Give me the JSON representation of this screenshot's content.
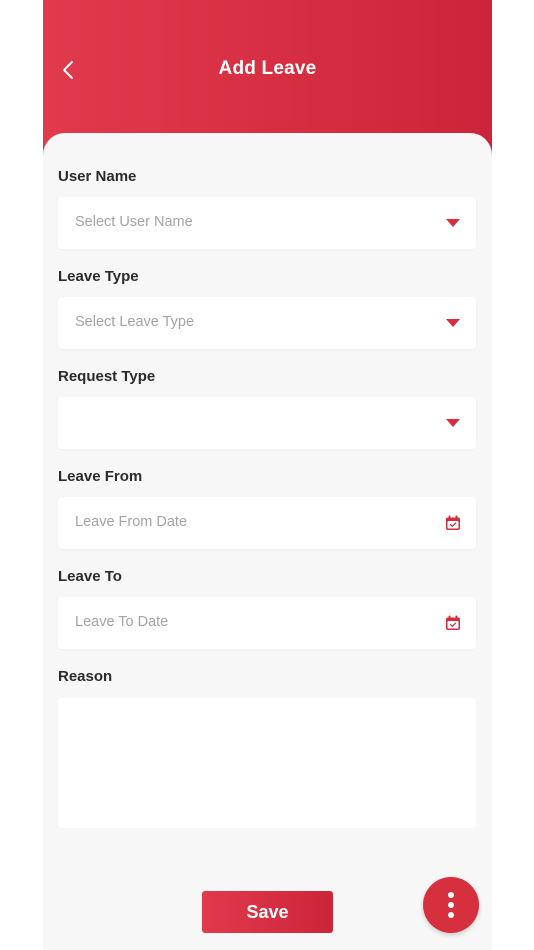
{
  "header": {
    "title": "Add Leave",
    "back_icon": "chevron-left-icon"
  },
  "form": {
    "user_name": {
      "label": "User Name",
      "placeholder": "Select User Name",
      "icon": "caret-down-icon"
    },
    "leave_type": {
      "label": "Leave Type",
      "placeholder": "Select Leave Type",
      "icon": "caret-down-icon"
    },
    "request_type": {
      "label": "Request Type",
      "placeholder": "",
      "icon": "caret-down-icon"
    },
    "leave_from": {
      "label": "Leave From",
      "placeholder": "Leave From Date",
      "icon": "calendar-icon"
    },
    "leave_to": {
      "label": "Leave To",
      "placeholder": "Leave To Date",
      "icon": "calendar-icon"
    },
    "reason": {
      "label": "Reason",
      "value": ""
    }
  },
  "actions": {
    "save_label": "Save",
    "more_icon": "more-vertical-icon"
  },
  "colors": {
    "accent": "#d62c40",
    "header_gradient_start": "#e23a4d",
    "header_gradient_end": "#cc2438",
    "background": "#f7f7f7",
    "placeholder_text": "#a4a4a4",
    "label_text": "#2b2b2b"
  }
}
